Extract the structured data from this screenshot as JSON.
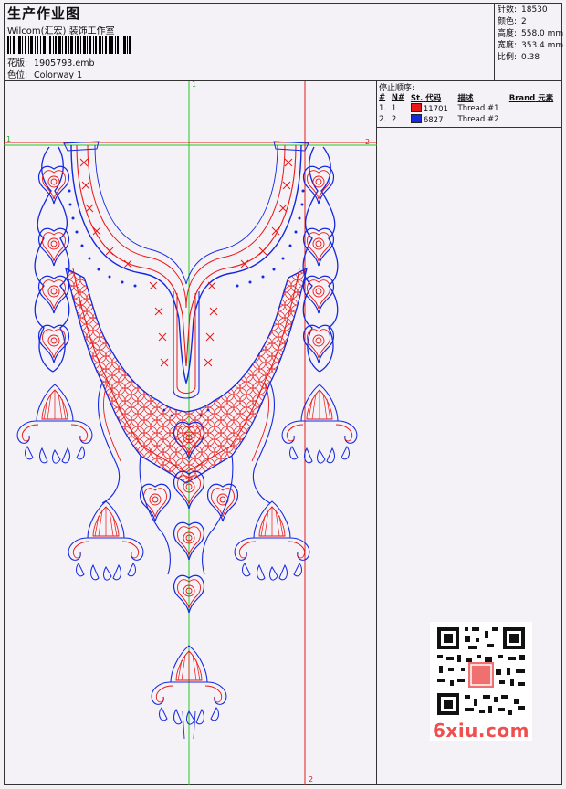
{
  "header": {
    "title": "生产作业图",
    "company": "Wilcom(汇宏) 装饰工作室",
    "design_label": "花版:",
    "design_value": "1905793.emb",
    "colorway_label": "色位:",
    "colorway_value": "Colorway 1"
  },
  "stats": [
    {
      "label": "针数:",
      "value": "18530"
    },
    {
      "label": "颜色:",
      "value": "2"
    },
    {
      "label": "高度:",
      "value": "558.0 mm"
    },
    {
      "label": "宽度:",
      "value": "353.4 mm"
    },
    {
      "label": "比例:",
      "value": "0.38"
    }
  ],
  "stop_sequence": {
    "title": "停止顺序:",
    "columns": [
      "#",
      "N#",
      "St.",
      "代码",
      "描述",
      "Brand",
      "元素"
    ],
    "rows": [
      {
        "n": "1.",
        "stop": "1",
        "color": "#e81818",
        "code": "11701",
        "desc": "Thread #1"
      },
      {
        "n": "2.",
        "stop": "2",
        "color": "#1428e0",
        "code": "6827",
        "desc": "Thread #2"
      }
    ]
  },
  "guides": {
    "top_left": "1",
    "top_right": "2",
    "vertical_top": "1",
    "vertical_bottom": "2"
  },
  "watermark": "6xiu.com",
  "colors": {
    "red": "#e81818",
    "blue": "#1428e0",
    "green": "#22cc22"
  }
}
